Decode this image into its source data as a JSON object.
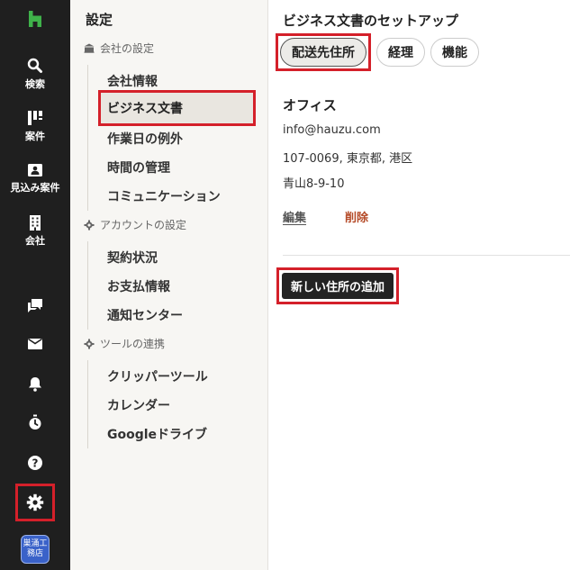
{
  "rail": {
    "items": [
      {
        "label": "検索",
        "icon": "search-icon"
      },
      {
        "label": "案件",
        "icon": "projects-icon"
      },
      {
        "label": "見込み案件",
        "icon": "leads-icon"
      },
      {
        "label": "会社",
        "icon": "company-icon"
      }
    ],
    "avatar_text": "巣涌工務店"
  },
  "settings": {
    "title": "設定",
    "sections": [
      {
        "title": "会社の設定",
        "icon": "company-icon",
        "items": [
          "会社情報",
          "ビジネス文書",
          "作業日の例外",
          "時間の管理",
          "コミュニケーション"
        ]
      },
      {
        "title": "アカウントの設定",
        "icon": "gear-icon",
        "items": [
          "契約状況",
          "お支払情報",
          "通知センター"
        ]
      },
      {
        "title": "ツールの連携",
        "icon": "gear-icon",
        "items": [
          "クリッパーツール",
          "カレンダー",
          "Googleドライブ"
        ]
      }
    ]
  },
  "main": {
    "title": "ビジネス文書のセットアップ",
    "tabs": [
      "配送先住所",
      "経理",
      "機能"
    ],
    "office": {
      "name": "オフィス",
      "email": "info@hauzu.com",
      "address1": "107-0069, 東京都, 港区",
      "address2": "青山8-9-10",
      "edit_label": "編集",
      "delete_label": "削除"
    },
    "add_button_label": "新しい住所の追加"
  },
  "colors": {
    "highlight": "#d4202a",
    "rail_bg": "#1f1f1f",
    "brand_green": "#3fb24a",
    "delete": "#b54b28"
  }
}
